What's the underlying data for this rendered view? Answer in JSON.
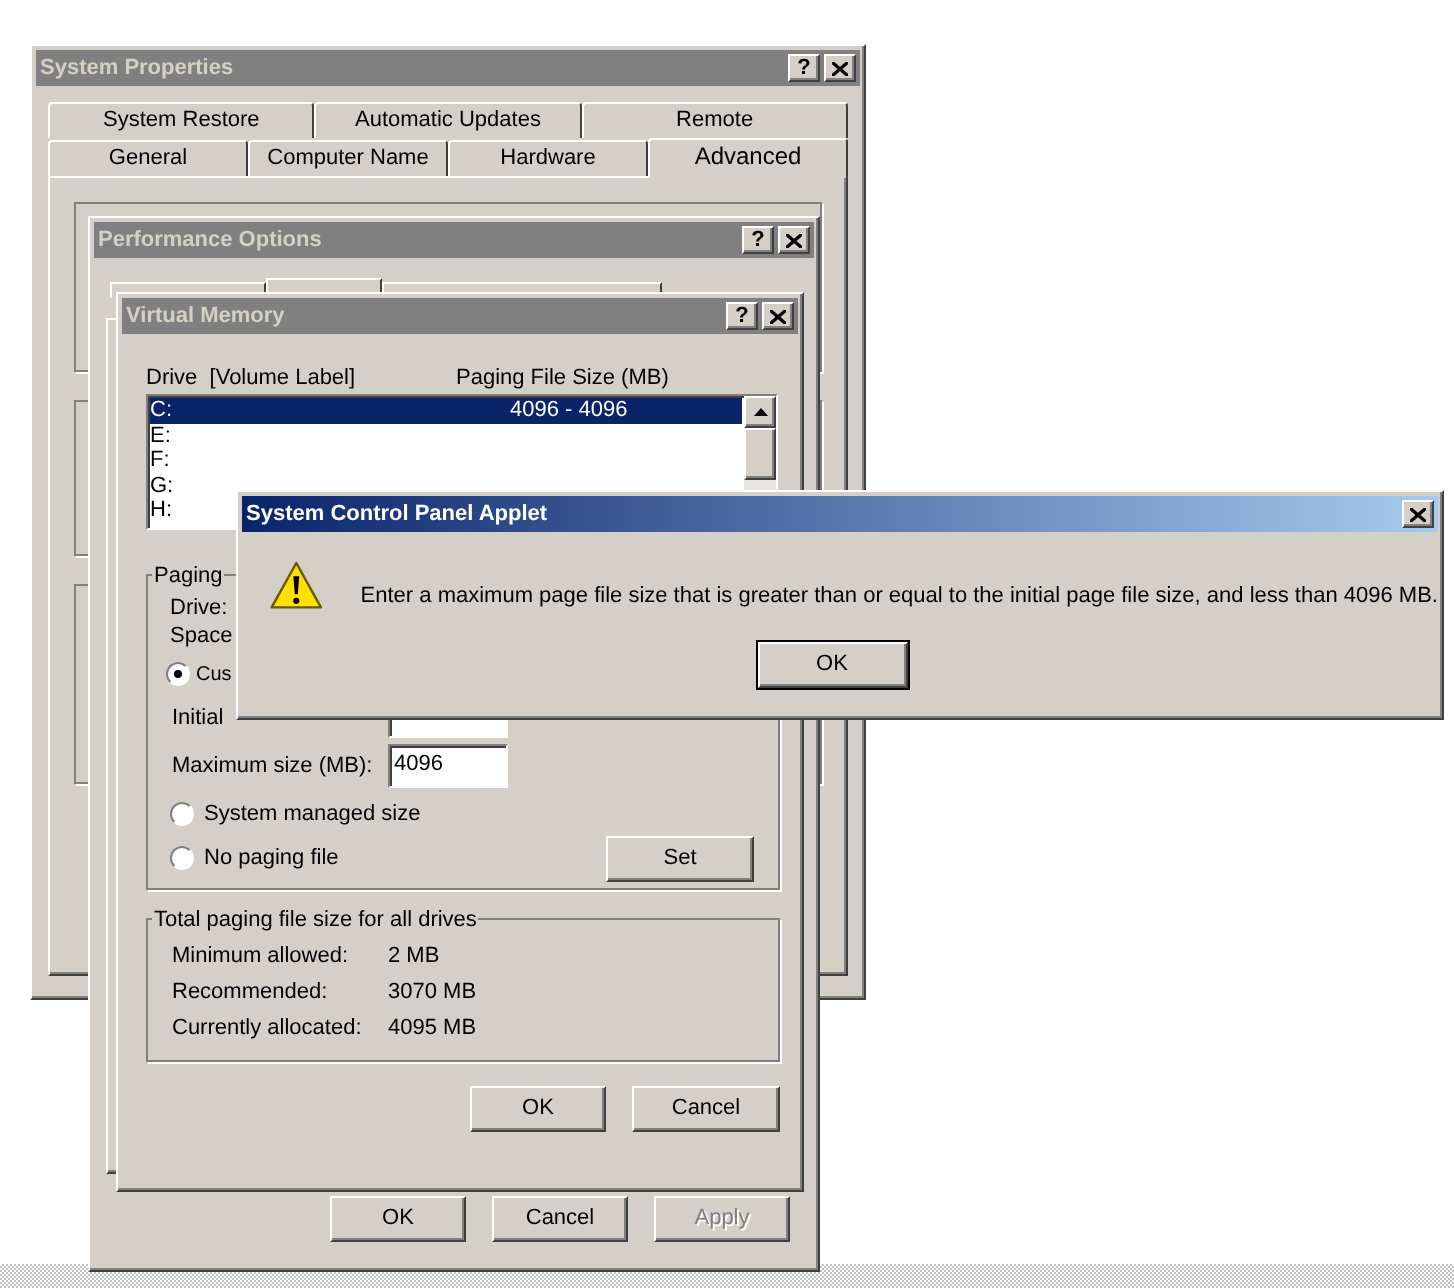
{
  "system_properties": {
    "title": "System Properties",
    "help": "?",
    "tab_rows": [
      [
        {
          "label": "System Restore",
          "selected": false
        },
        {
          "label": "Automatic Updates",
          "selected": false
        },
        {
          "label": "Remote",
          "selected": false
        }
      ],
      [
        {
          "label": "General",
          "selected": false
        },
        {
          "label": "Computer Name",
          "selected": false
        },
        {
          "label": "Hardware",
          "selected": false
        },
        {
          "label": "Advanced",
          "selected": true
        }
      ]
    ]
  },
  "performance_options": {
    "title": "Performance Options",
    "help": "?",
    "buttons": [
      {
        "label": "OK",
        "disabled": false
      },
      {
        "label": "Cancel",
        "disabled": false
      },
      {
        "label": "Apply",
        "disabled": true
      }
    ]
  },
  "virtual_memory": {
    "title": "Virtual Memory",
    "help": "?",
    "columns": [
      "Drive  [Volume Label]",
      "Paging File Size (MB)"
    ],
    "drives": [
      {
        "drive": "C:",
        "size": "4096 - 4096",
        "selected": true
      },
      {
        "drive": "E:",
        "selected": false
      },
      {
        "drive": "F:",
        "selected": false
      },
      {
        "drive": "G:",
        "selected": false
      },
      {
        "drive": "H:",
        "selected": false
      }
    ],
    "paging_group": {
      "title": "Paging",
      "drive_label": "Drive:",
      "space_label": "Space",
      "options": [
        {
          "label": "Cus",
          "selected": true
        },
        {
          "label": "System managed size",
          "selected": false
        },
        {
          "label": "No paging file",
          "selected": false
        }
      ],
      "initial_label": "Initial",
      "maximum_label": "Maximum size (MB):",
      "maximum_value": "4096",
      "set_button": "Set"
    },
    "total_group": {
      "title": "Total paging file size for all drives",
      "rows": [
        {
          "label": "Minimum allowed:",
          "value": "2 MB"
        },
        {
          "label": "Recommended:",
          "value": "3070 MB"
        },
        {
          "label": "Currently allocated:",
          "value": "4095 MB"
        }
      ]
    },
    "buttons": [
      "OK",
      "Cancel"
    ]
  },
  "alert": {
    "title": "System Control Panel Applet",
    "message": "Enter a maximum page file size that is greater than or equal to the initial page file size, and less than 4096 MB.",
    "button": "OK"
  }
}
